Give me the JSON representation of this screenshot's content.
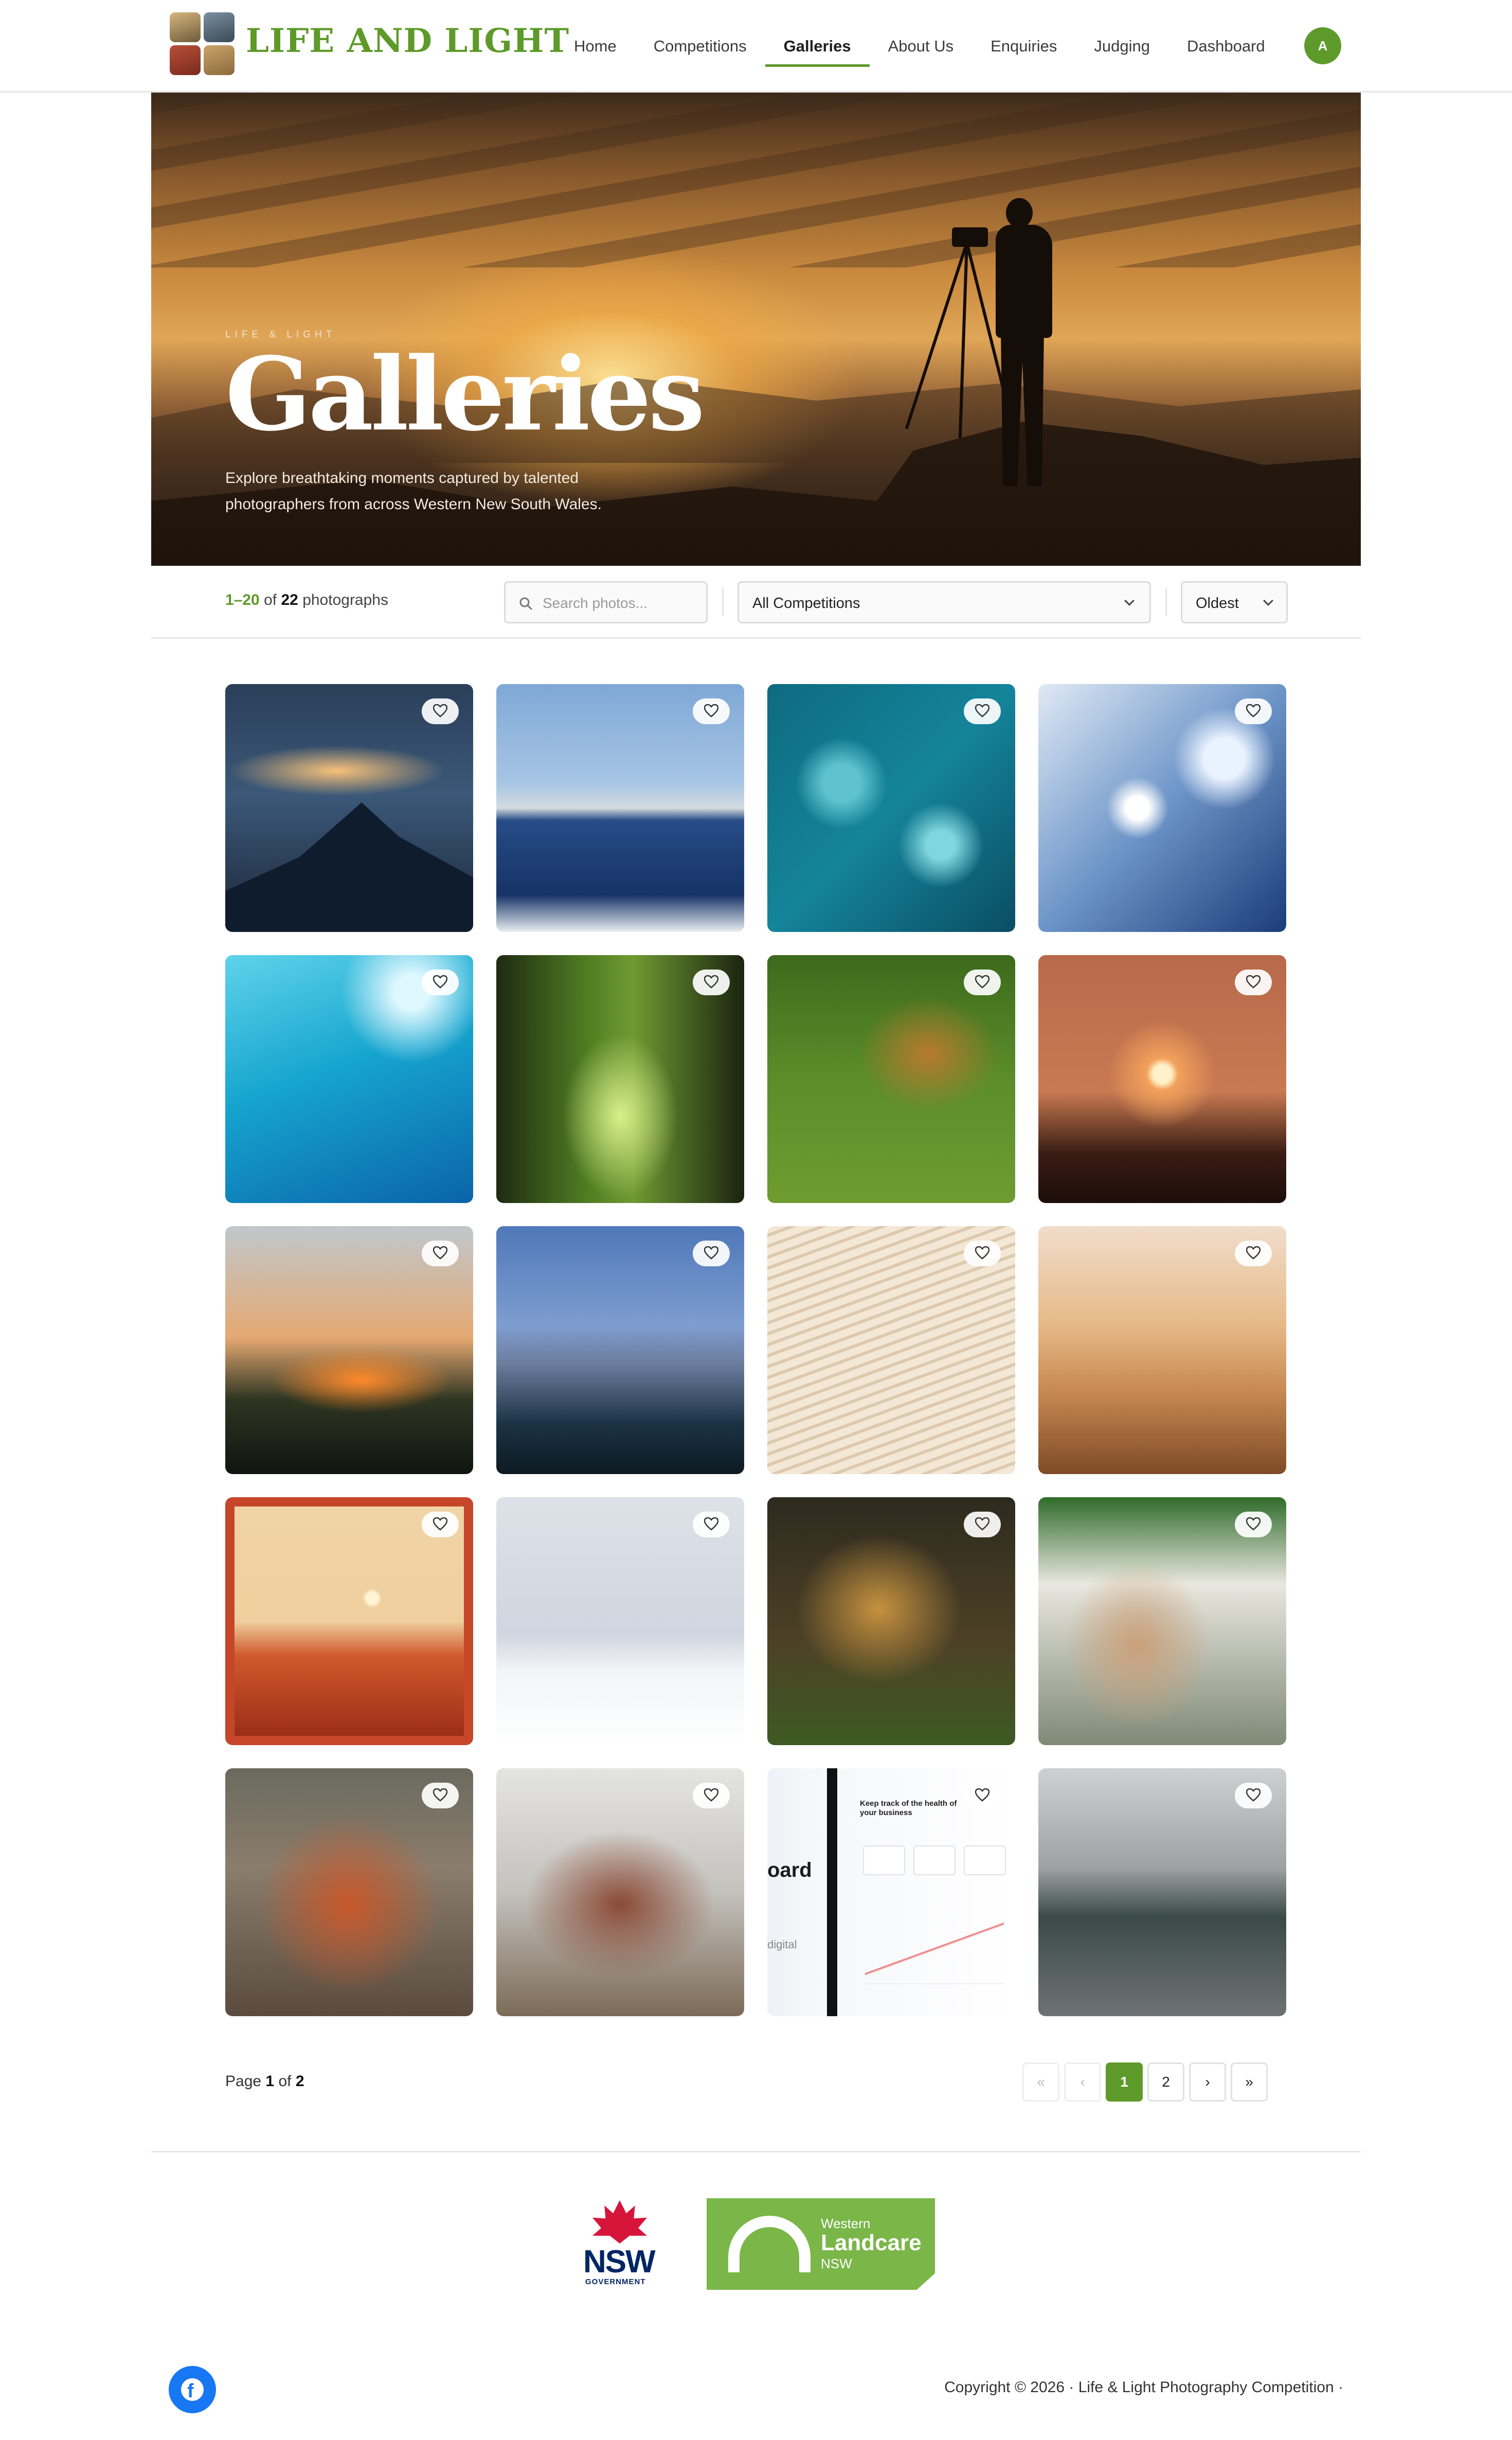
{
  "header": {
    "brand": "LIFE AND LIGHT",
    "nav": [
      {
        "label": "Home"
      },
      {
        "label": "Competitions"
      },
      {
        "label": "Galleries",
        "active": true
      },
      {
        "label": "About Us"
      },
      {
        "label": "Enquiries"
      },
      {
        "label": "Judging"
      },
      {
        "label": "Dashboard"
      }
    ],
    "avatar_initial": "A"
  },
  "hero": {
    "eyebrow": "LIFE & LIGHT",
    "title": "Galleries",
    "description": "Explore breathtaking moments captured by talented photographers from across Western New South Wales."
  },
  "filters": {
    "count_range": "1–20",
    "count_of": "of",
    "count_total": "22",
    "count_unit": "photographs",
    "search_placeholder": "Search photos...",
    "competition_selected": "All Competitions",
    "sort_selected": "Oldest"
  },
  "gallery": {
    "photos": [
      {
        "subject": "snow mountain at sunset"
      },
      {
        "subject": "ocean horizon"
      },
      {
        "subject": "turquoise sea water"
      },
      {
        "subject": "water splash"
      },
      {
        "subject": "underwater bubbles"
      },
      {
        "subject": "deer in forest"
      },
      {
        "subject": "lions on grass"
      },
      {
        "subject": "sunset over trees"
      },
      {
        "subject": "sunset silhouette"
      },
      {
        "subject": "blue dusk landscape"
      },
      {
        "subject": "white sand dune"
      },
      {
        "subject": "camel caravan in desert"
      },
      {
        "subject": "desert illustration poster"
      },
      {
        "subject": "snowy park trees"
      },
      {
        "subject": "lioness resting"
      },
      {
        "subject": "friends dining outdoors"
      },
      {
        "subject": "friends celebrating"
      },
      {
        "subject": "friends toasting wine"
      },
      {
        "subject": "business dashboard screenshot"
      },
      {
        "subject": "misty lake and forest"
      }
    ],
    "dashboard_tile": {
      "word": "oard",
      "heading": "Keep track of the health of your business",
      "side_word": "digital"
    }
  },
  "pagination": {
    "label_page": "Page",
    "current": "1",
    "label_of": "of",
    "total": "2",
    "first": "«",
    "prev": "‹",
    "pages": [
      "1",
      "2"
    ],
    "next": "›",
    "last": "»"
  },
  "footer": {
    "nsw_text": "NSW",
    "nsw_sub": "GOVERNMENT",
    "landcare_top": "Western",
    "landcare_main": "Landcare",
    "landcare_bottom": "NSW",
    "copyright": "Copyright © 2026 · Life & Light Photography Competition ·"
  },
  "colors": {
    "accent": "#5e9a2a",
    "facebook": "#1877f2",
    "nsw_red": "#d7153a",
    "landcare_green": "#7ab648"
  },
  "icons": [
    "search-icon",
    "chevron-down-icon",
    "heart-icon",
    "facebook-icon"
  ]
}
